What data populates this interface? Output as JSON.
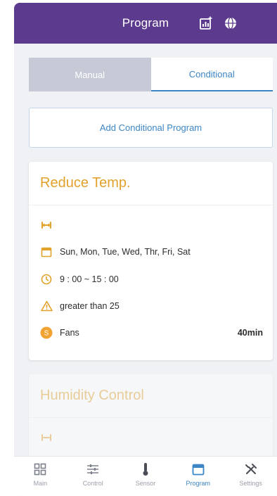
{
  "header": {
    "title": "Program"
  },
  "segments": {
    "manual": "Manual",
    "conditional": "Conditional"
  },
  "add_button": "Add Conditional Program",
  "programs": [
    {
      "title": "Reduce Temp.",
      "days": "Sun, Mon, Tue, Wed, Thr, Fri, Sat",
      "time": "9 : 00 ~ 15 : 00",
      "condition": "greater than 25",
      "device_badge": "S",
      "device": "Fans",
      "duration": "40min"
    },
    {
      "title": "Humidity Control"
    }
  ],
  "tabs": [
    {
      "label": "Main",
      "icon": "grid-icon"
    },
    {
      "label": "Control",
      "icon": "sliders-icon"
    },
    {
      "label": "Sensor",
      "icon": "thermometer-icon"
    },
    {
      "label": "Program",
      "icon": "calendar-icon"
    },
    {
      "label": "Settings",
      "icon": "tools-icon"
    }
  ],
  "colors": {
    "header": "#5c3a8e",
    "accent": "#3d86c6",
    "title_orange": "#e2a12b",
    "badge_orange": "#f0a232"
  }
}
